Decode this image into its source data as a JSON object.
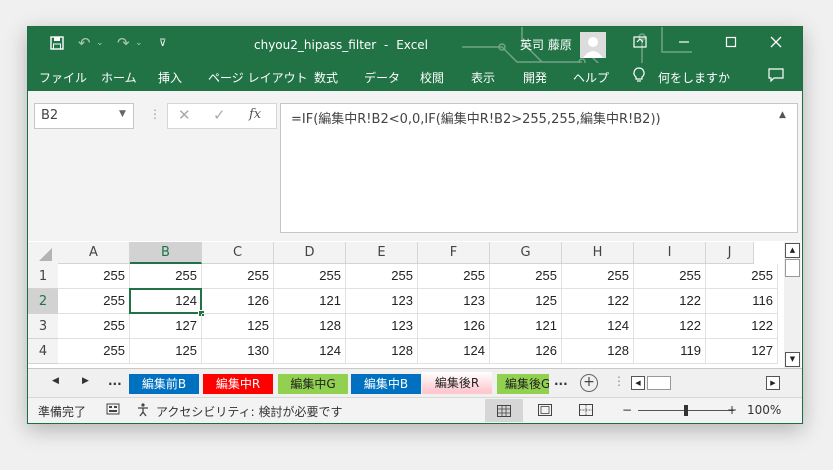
{
  "title": {
    "document": "chyou2_hipass_filter",
    "separator": "-",
    "app": "Excel",
    "user": "英司 藤原"
  },
  "ribbon": {
    "tabs": [
      "ファイル",
      "ホーム",
      "挿入",
      "ページ レイアウト",
      "数式",
      "データ",
      "校閲",
      "表示",
      "開発",
      "ヘルプ"
    ],
    "tell_me": "何をしますか"
  },
  "formula_bar": {
    "name_box": "B2",
    "fx_label": "fx",
    "formula": "=IF(編集中R!B2<0,0,IF(編集中R!B2>255,255,編集中R!B2))"
  },
  "grid": {
    "columns": [
      "A",
      "B",
      "C",
      "D",
      "E",
      "F",
      "G",
      "H",
      "I",
      "J"
    ],
    "rows": [
      {
        "num": "1",
        "cells": [
          "255",
          "255",
          "255",
          "255",
          "255",
          "255",
          "255",
          "255",
          "255",
          "255"
        ]
      },
      {
        "num": "2",
        "cells": [
          "255",
          "124",
          "126",
          "121",
          "123",
          "123",
          "125",
          "122",
          "122",
          "116"
        ]
      },
      {
        "num": "3",
        "cells": [
          "255",
          "127",
          "125",
          "128",
          "123",
          "126",
          "121",
          "124",
          "122",
          "122"
        ]
      },
      {
        "num": "4",
        "cells": [
          "255",
          "125",
          "130",
          "124",
          "128",
          "124",
          "126",
          "128",
          "119",
          "127"
        ]
      }
    ],
    "selected": {
      "col": "B",
      "row": "2"
    }
  },
  "sheet_tabs": {
    "more_left": "...",
    "more_right": "...",
    "tabs": [
      {
        "label": "編集前B",
        "bg": "#0070c0",
        "fg": "#ffffff"
      },
      {
        "label": "編集中R",
        "bg": "#ff0000",
        "fg": "#ffffff"
      },
      {
        "label": "編集中G",
        "bg": "#92d050",
        "fg": "#222222"
      },
      {
        "label": "編集中B",
        "bg": "#0070c0",
        "fg": "#ffffff"
      },
      {
        "label": "編集後R",
        "bg": "#ffc7ce",
        "fg": "#222222",
        "active": true
      },
      {
        "label": "編集後G",
        "bg": "#92d050",
        "fg": "#222222"
      }
    ]
  },
  "status": {
    "ready": "準備完了",
    "accessibility": "アクセシビリティ: 検討が必要です",
    "zoom": "100%",
    "zoom_minus": "−",
    "zoom_plus": "+",
    "zoom_level": 0.5
  },
  "colors": {
    "accent": "#217346"
  }
}
